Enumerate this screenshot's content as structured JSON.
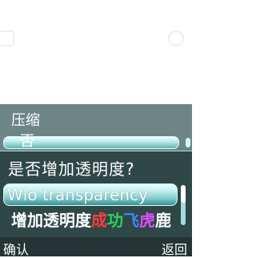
{
  "background_menu": {
    "item_1": "压缩",
    "item_2": "否"
  },
  "dialog": {
    "title": "是否增加透明度?",
    "selected_option": "Wlo transparency",
    "option_2_segments": [
      "增加透明度",
      "成",
      "功",
      "飞",
      "虎",
      "鹿"
    ],
    "colors": {
      "panel": "#2f4747",
      "highlight": "#7cc7c7"
    }
  },
  "softkeys": {
    "left": "确认",
    "right": "返回"
  },
  "icons": [
    "app-icon-left",
    "app-icon-right",
    "scrollbar"
  ]
}
